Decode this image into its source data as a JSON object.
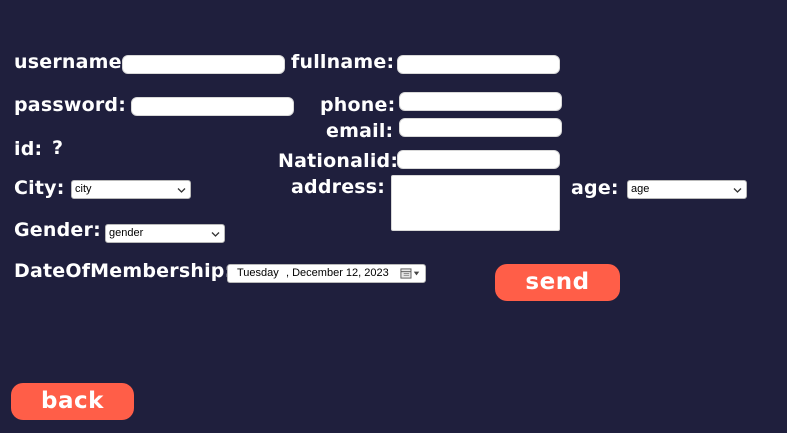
{
  "form": {
    "username_label": "username:",
    "fullname_label": "fullname:",
    "password_label": "password:",
    "phone_label": "phone:",
    "email_label": "email:",
    "id_label": "id:",
    "id_value": "?",
    "nationalid_label": "Nationalid:",
    "city_label": "City:",
    "city_value": "city",
    "address_label": "address:",
    "age_label": "age:",
    "age_value": "age",
    "gender_label": "Gender:",
    "gender_value": "gender",
    "membership_label": "DateOfMembership:",
    "membership_day": "Tuesday",
    "membership_date": ", December 12, 2023"
  },
  "buttons": {
    "send": "send",
    "back": "back"
  },
  "icons": {
    "calendar": "calendar-icon",
    "dropdown": "chevron-down-icon"
  },
  "colors": {
    "background": "#1f1f3d",
    "accent": "#ff5e48"
  }
}
